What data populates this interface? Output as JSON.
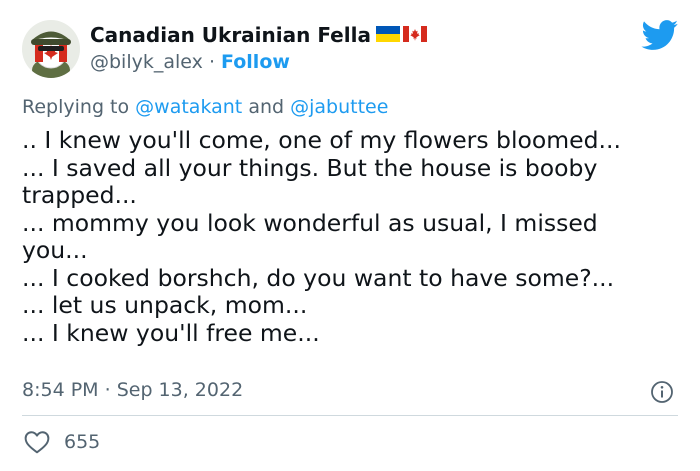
{
  "author": {
    "name": "Canadian Ukrainian Fella",
    "handle": "@bilyk_alex",
    "separator": "·",
    "follow_label": "Follow"
  },
  "flags": [
    "ukraine-flag",
    "canada-flag"
  ],
  "reply": {
    "prefix": "Replying to",
    "mention1": "@watakant",
    "joiner": "and",
    "mention2": "@jabuttee"
  },
  "tweet": {
    "lines": [
      ".. I knew you'll come, one of my flowers bloomed...",
      "... I saved all your things. But the  house is booby",
      "trapped...",
      "... mommy you look wonderful as usual, I missed",
      "you...",
      "... I cooked borshch, do you want to have some?...",
      "... let us unpack, mom...",
      "... I knew you'll free me..."
    ]
  },
  "meta": {
    "time": "8:54 PM",
    "separator": "·",
    "date": "Sep 13, 2022"
  },
  "likes": {
    "count": "655"
  },
  "colors": {
    "accent": "#1d9bf0",
    "secondary_text": "#536471",
    "text": "#0f1419",
    "divider": "#cfd9de"
  },
  "icons": [
    "twitter-bird-icon",
    "info-icon",
    "heart-icon"
  ]
}
